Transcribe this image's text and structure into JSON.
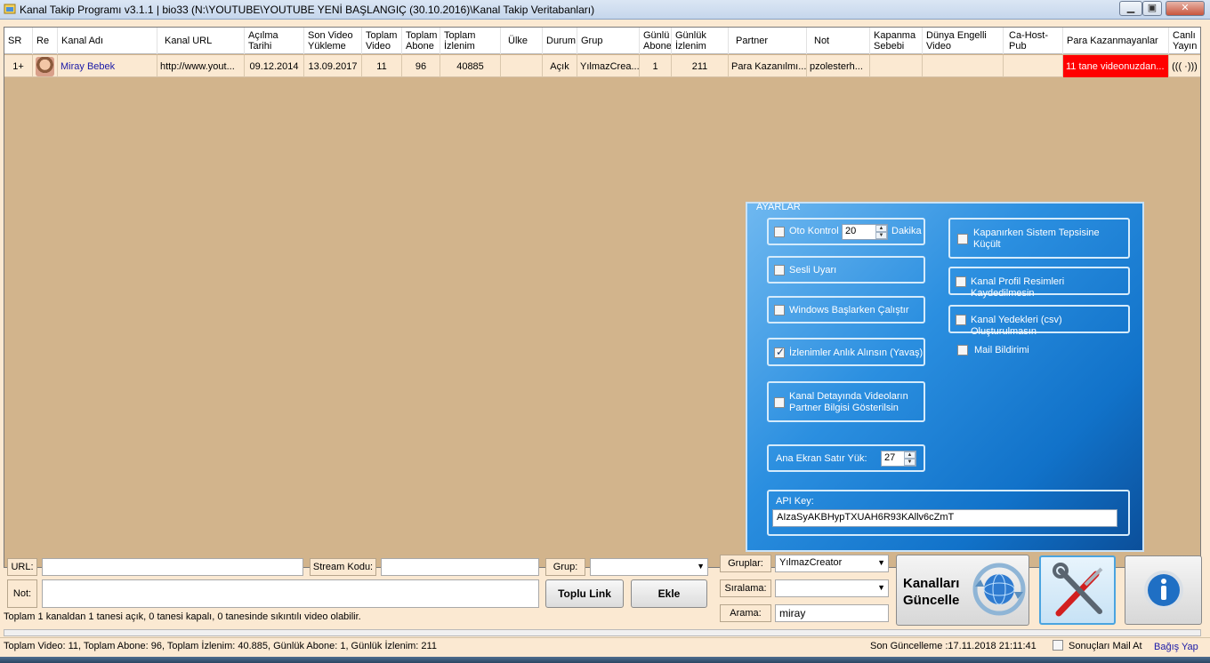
{
  "window": {
    "title": "Kanal Takip Programı v3.1.1 | bio33 (N:\\YOUTUBE\\YOUTUBE YENİ BAŞLANGIÇ (30.10.2016)\\Kanal Takip Veritabanları)"
  },
  "grid": {
    "headers": [
      "SR",
      "Re",
      "Kanal Adı",
      "Kanal URL",
      "Açılma\nTarihi",
      "Son Video\nYükleme",
      "Toplam\nVideo",
      "Toplam\nAbone",
      "Toplam\nİzlenim",
      "Ülke",
      "Durum",
      "Grup",
      "Günlü\nAbone",
      "Günlük\nİzlenim",
      "Partner",
      "Not",
      "Kapanma\nSebebi",
      "Dünya Engelli\nVideo",
      "Ca-Host-Pub",
      "Para Kazanmayanlar",
      "Canlı\nYayın"
    ],
    "rows": [
      {
        "sr": "1+",
        "name": "Miray Bebek",
        "url": "http://www.yout...",
        "opened": "09.12.2014",
        "last_upload": "13.09.2017",
        "videos": "11",
        "subs": "96",
        "views": "40885",
        "country": "",
        "status": "Açık",
        "group": "YılmazCrea...",
        "daily_subs": "1",
        "daily_views": "211",
        "partner": "Para Kazanılmı...",
        "note": "pzolesterh...",
        "close_reason": "",
        "blocked": "",
        "host": "",
        "monetization": "11 tane videonuzdan...",
        "live": "((( ·)))"
      }
    ]
  },
  "settings": {
    "legend": "AYARLAR",
    "oto_kontrol": "Oto Kontrol",
    "oto_value": "20",
    "dakika": "Dakika",
    "sesli_uyari": "Sesli Uyarı",
    "windows_start": "Windows Başlarken Çalıştır",
    "izlenim_anlik": "İzlenimler Anlık Alınsın (Yavaş)",
    "kanal_detay": "Kanal Detayında Videoların Partner Bilgisi Gösterilsin",
    "satir_yuk": "Ana Ekran Satır Yük:",
    "satir_value": "27",
    "tray": "Kapanırken Sistem Tepsisine Küçült",
    "profil": "Kanal Profil Resimleri Kaydedilmesin",
    "yedek": "Kanal Yedekleri (csv) Oluşturulmasın",
    "mail": "Mail Bildirimi",
    "api_label": "API Key:",
    "api_value": "AIzaSyAKBHypTXUAH6R93KAllv6cZmT"
  },
  "bottom": {
    "url_label": "URL:",
    "url_value": "",
    "stream_label": "Stream Kodu:",
    "stream_value": "",
    "grup_label": "Grup:",
    "grup_value": "",
    "not_label": "Not:",
    "not_value": "",
    "toplu_link": "Toplu Link",
    "ekle": "Ekle",
    "gruplar_label": "Gruplar:",
    "gruplar_value": "YılmazCreator",
    "siralama_label": "Sıralama:",
    "siralama_value": "",
    "arama_label": "Arama:",
    "arama_value": "miray",
    "update_btn": "Kanalları Güncelle",
    "summary": "Toplam 1 kanaldan 1 tanesi açık, 0 tanesi kapalı, 0 tanesinde sıkıntılı video olabilir."
  },
  "statusbar": {
    "totals": "Toplam Video: 11, Toplam Abone: 96, Toplam İzlenim: 40.885, Günlük Abone: 1, Günlük İzlenim: 211",
    "last_update": "Son Güncelleme :17.11.2018 21:11:41",
    "mail_check": "Sonuçları Mail At",
    "donate": "Bağış Yap"
  },
  "colors": {
    "grid_bg": "#d2b48c",
    "row_bg": "#fbe9d2",
    "alert": "#ff0000",
    "panel": "#1172c9"
  }
}
